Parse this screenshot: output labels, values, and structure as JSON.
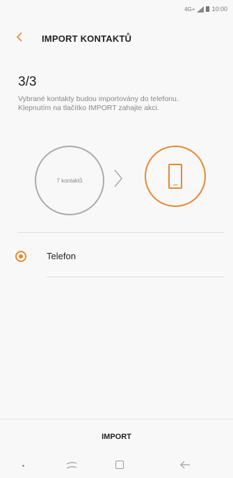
{
  "status_bar": {
    "network": "4G+",
    "time": "10:00"
  },
  "header": {
    "title": "IMPORT KONTAKTŮ"
  },
  "step": {
    "label": "3/3"
  },
  "description": "Vybrané kontakty budou importovány do telefonu. Klepnutím na tlačítko IMPORT zahajte akci.",
  "flow": {
    "source_label": "7 kontaktů"
  },
  "options": [
    {
      "label": "Telefon",
      "selected": true
    }
  ],
  "footer": {
    "import_label": "IMPORT"
  },
  "colors": {
    "accent": "#e8872d"
  },
  "icons": {
    "back": "chevron-left-icon",
    "arrow": "chevron-right-icon",
    "phone": "phone-icon"
  }
}
